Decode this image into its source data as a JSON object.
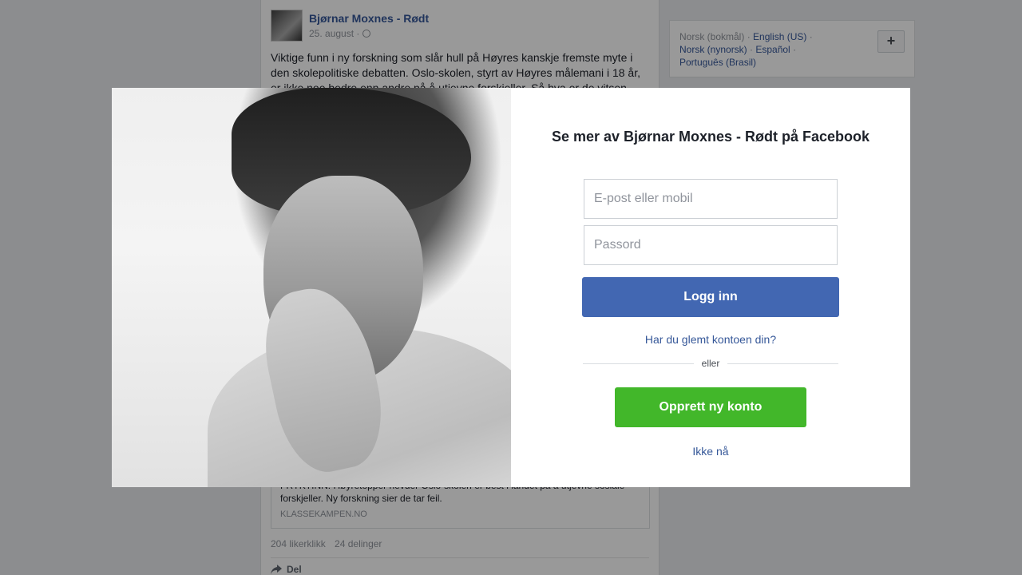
{
  "post": {
    "author": "Bjørnar Moxnes - Rødt",
    "date": "25. august · ",
    "text": "Viktige funn i ny forskning som slår hull på Høyres kanskje fremste myte i den skolepolitiske debatten. Oslo-skolen, styrt av Høyres målemani i 18 år, er ikke noe bedre enn andre på å utjevne forskjeller. Så hva er de vitsen",
    "link_description": "FRYKTINN: Høyretopper hevder Oslo-skolen er best i landet på å utjevne sosiale forskjeller. Ny forskning sier de tar feil.",
    "link_domain": "KLASSEKAMPEN.NO",
    "likes": "204 likerklikk",
    "shares": "24 delinger",
    "share_label": "Del"
  },
  "languages": {
    "current": "Norsk (bokmål)",
    "links": [
      "English (US)",
      "Norsk (nynorsk)",
      "Español",
      "Português (Brasil)"
    ],
    "add_label": "+"
  },
  "modal": {
    "title": "Se mer av Bjørnar Moxnes - Rødt på Facebook",
    "email_placeholder": "E-post eller mobil",
    "password_placeholder": "Passord",
    "login_label": "Logg inn",
    "forgot_label": "Har du glemt kontoen din?",
    "or_label": "eller",
    "create_label": "Opprett ny konto",
    "not_now_label": "Ikke nå"
  },
  "colors": {
    "brand_blue": "#4267b2",
    "link_blue": "#365899",
    "create_green": "#42b72a"
  }
}
